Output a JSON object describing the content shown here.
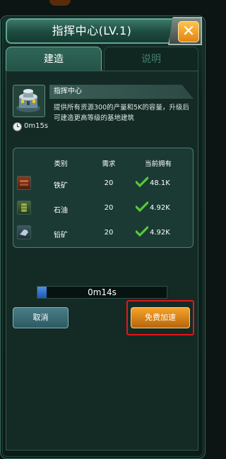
{
  "dialog": {
    "title": "指挥中心(LV.1)",
    "close_symbol": "✕"
  },
  "tabs": [
    {
      "label": "建造",
      "active": true
    },
    {
      "label": "说明",
      "active": false
    }
  ],
  "building": {
    "icon": "command-center-icon",
    "name": "指挥中心",
    "description_lines": [
      "提供所有资源300的产量和5K的容量，升级后",
      "可建造更高等级的基地建筑"
    ],
    "build_time": "0m15s"
  },
  "requirements": {
    "columns": [
      "类别",
      "需求",
      "当前拥有"
    ],
    "rows": [
      {
        "icon": "iron-ore-icon",
        "category": "铁矿",
        "required": "20",
        "owned": "48.1K",
        "met": true
      },
      {
        "icon": "oil-barrel-icon",
        "category": "石油",
        "required": "20",
        "owned": "4.92K",
        "met": true
      },
      {
        "icon": "lead-ore-icon",
        "category": "铅矿",
        "required": "20",
        "owned": "4.92K",
        "met": true
      }
    ]
  },
  "timer": {
    "remaining": "0m14s",
    "progress_fraction": 0.07
  },
  "buttons": {
    "cancel": "取消",
    "free_speedup": "免费加速"
  },
  "colors": {
    "accent_green": "#3f7f6c",
    "check_green": "#57c83a",
    "speedup_orange": "#f5a22a",
    "highlight_red": "#e8141a"
  }
}
